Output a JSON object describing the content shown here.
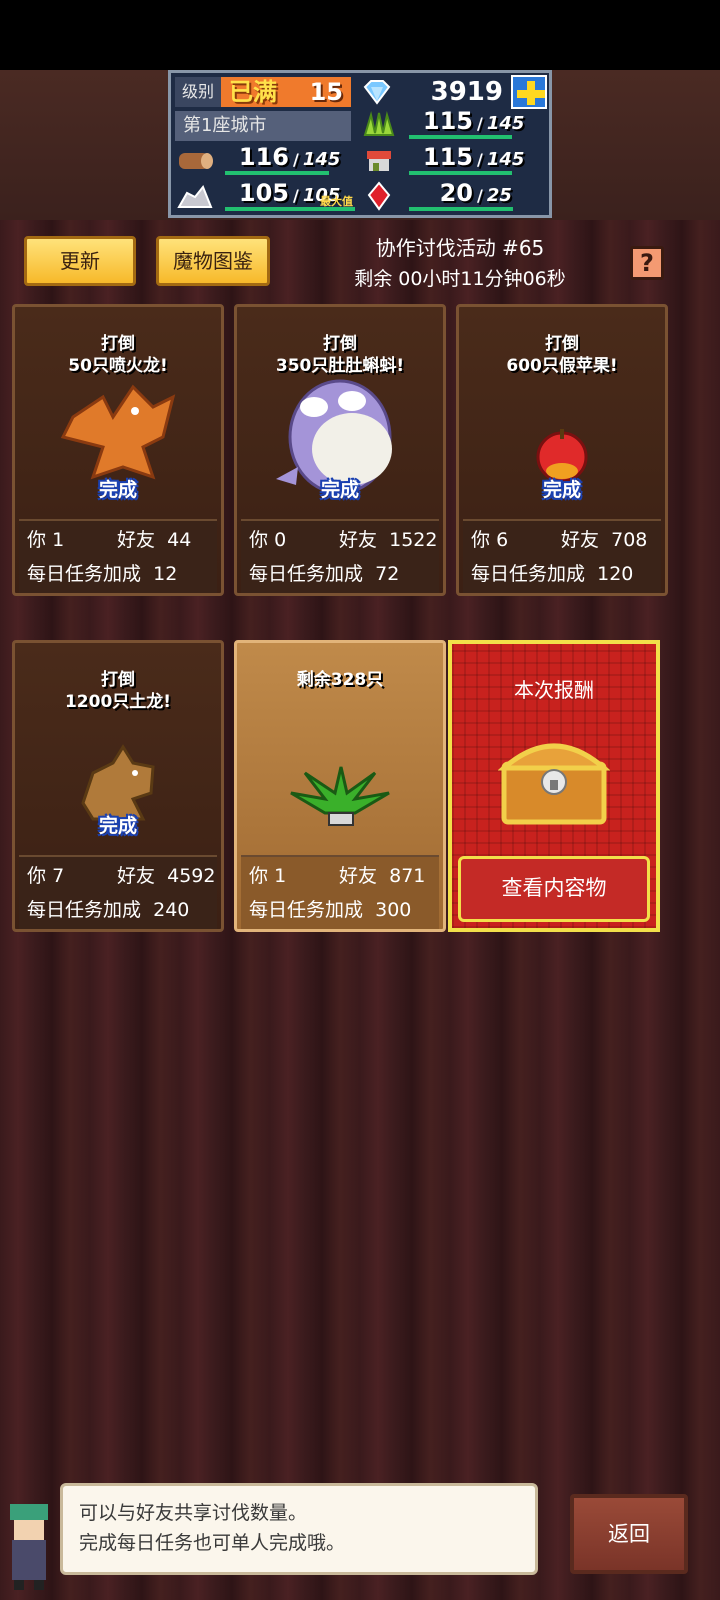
{
  "hud": {
    "level_label": "级别",
    "level_status": "已满",
    "level_value": "15",
    "city": "第1座城市",
    "gems": "3919",
    "resources": [
      {
        "icon": "wood-log-icon",
        "current": "116",
        "max": "145"
      },
      {
        "icon": "grass-icon",
        "current": "115",
        "max": "145"
      },
      {
        "icon": "market-stall-icon",
        "current": "115",
        "max": "145"
      },
      {
        "icon": "ore-icon",
        "current": "105",
        "max": "105",
        "max_tag": "最大值"
      },
      {
        "icon": "red-crystal-icon",
        "current": "20",
        "max": "25"
      }
    ]
  },
  "actions": {
    "refresh": "更新",
    "bestiary": "魔物图鉴",
    "help": "?"
  },
  "event": {
    "title": "协作讨伐活动 #65",
    "remaining": "剩余 00小时11分钟06秒"
  },
  "cards": [
    {
      "head1": "打倒",
      "head2": "50只喷火龙!",
      "status": "完成",
      "you_label": "你",
      "you": "1",
      "friend_label": "好友",
      "friend": "44",
      "bonus_label": "每日任务加成",
      "bonus": "12"
    },
    {
      "head1": "打倒",
      "head2": "350只肚肚蝌蚪!",
      "status": "完成",
      "you_label": "你",
      "you": "0",
      "friend_label": "好友",
      "friend": "1522",
      "bonus_label": "每日任务加成",
      "bonus": "72"
    },
    {
      "head1": "打倒",
      "head2": "600只假苹果!",
      "status": "完成",
      "you_label": "你",
      "you": "6",
      "friend_label": "好友",
      "friend": "708",
      "bonus_label": "每日任务加成",
      "bonus": "120"
    },
    {
      "head1": "打倒",
      "head2": "1200只土龙!",
      "status": "完成",
      "you_label": "你",
      "you": "7",
      "friend_label": "好友",
      "friend": "4592",
      "bonus_label": "每日任务加成",
      "bonus": "240"
    },
    {
      "head1": "剩余328只",
      "head2": "",
      "status": "",
      "you_label": "你",
      "you": "1",
      "friend_label": "好友",
      "friend": "871",
      "bonus_label": "每日任务加成",
      "bonus": "300"
    }
  ],
  "reward": {
    "title": "本次报酬",
    "view_button": "查看内容物"
  },
  "dialog": {
    "line1": "可以与好友共享讨伐数量。",
    "line2": "完成每日任务也可单人完成哦。"
  },
  "back": "返回"
}
